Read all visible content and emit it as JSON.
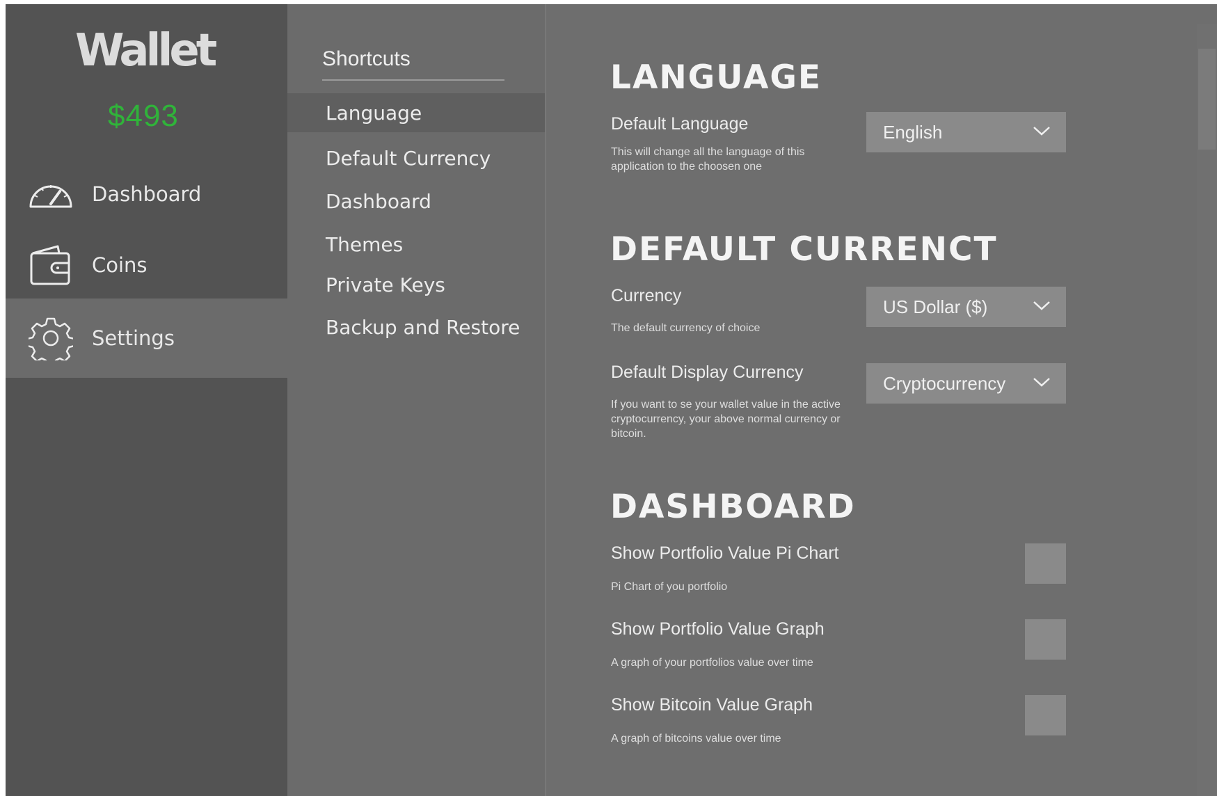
{
  "app": {
    "name": "Wallet",
    "balance": "$493"
  },
  "nav": [
    {
      "label": "Dashboard",
      "icon": "speedometer-icon"
    },
    {
      "label": "Coins",
      "icon": "wallet-icon"
    },
    {
      "label": "Settings",
      "icon": "gear-icon",
      "active": true
    }
  ],
  "shortcuts": {
    "title": "Shortcuts",
    "items": [
      "Language",
      "Default Currency",
      "Dashboard",
      "Themes",
      "Private Keys",
      "Backup and Restore"
    ],
    "active_index": 0
  },
  "sections": {
    "language": {
      "title": "LANGUAGE",
      "default_language": {
        "label": "Default Language",
        "description": "This will change all the language of this application to the choosen one",
        "value": "English"
      }
    },
    "currency": {
      "title": "DEFAULT CURRENCT",
      "currency": {
        "label": "Currency",
        "description": "The default currency of choice",
        "value": "US Dollar ($)"
      },
      "display_currency": {
        "label": "Default Display Currency",
        "description": "If you want to se your wallet value in the active cryptocurrency, your above normal currency or bitcoin.",
        "value": "Cryptocurrency"
      }
    },
    "dashboard": {
      "title": "DASHBOARD",
      "pi_chart": {
        "label": "Show Portfolio Value Pi Chart",
        "description": "Pi Chart of you portfolio",
        "checked": false
      },
      "value_graph": {
        "label": "Show Portfolio Value Graph",
        "description": "A graph of your portfolios value over time",
        "checked": false
      },
      "bitcoin_graph": {
        "label": "Show Bitcoin Value Graph",
        "description": "A graph of bitcoins value over time",
        "checked": false
      }
    }
  },
  "colors": {
    "balance": "#30b33a",
    "sidebar": "#535353",
    "panel": "#6e6e6e",
    "control": "#8a8a8a"
  }
}
